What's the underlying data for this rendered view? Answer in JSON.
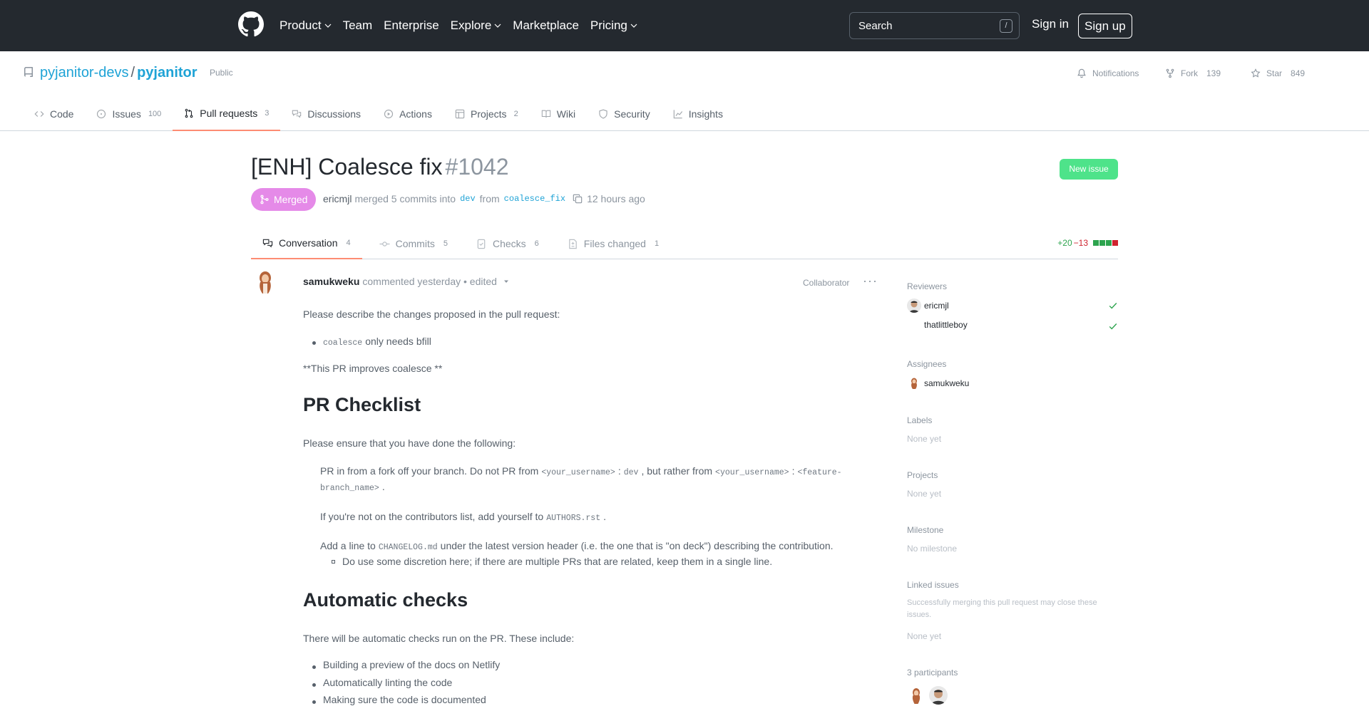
{
  "header": {
    "nav": [
      {
        "label": "Product",
        "dropdown": true
      },
      {
        "label": "Team",
        "dropdown": false
      },
      {
        "label": "Enterprise",
        "dropdown": false
      },
      {
        "label": "Explore",
        "dropdown": true
      },
      {
        "label": "Marketplace",
        "dropdown": false
      },
      {
        "label": "Pricing",
        "dropdown": true
      }
    ],
    "search_placeholder": "Search",
    "search_shortcut": "/",
    "sign_in": "Sign in",
    "sign_up": "Sign up"
  },
  "repo": {
    "owner": "pyjanitor-devs",
    "separator": "/",
    "name": "pyjanitor",
    "visibility": "Public",
    "notifications_label": "Notifications",
    "fork_label": "Fork",
    "fork_count": "139",
    "star_label": "Star",
    "star_count": "849",
    "tabs": [
      {
        "label": "Code",
        "count": ""
      },
      {
        "label": "Issues",
        "count": "100"
      },
      {
        "label": "Pull requests",
        "count": "3"
      },
      {
        "label": "Discussions",
        "count": ""
      },
      {
        "label": "Actions",
        "count": ""
      },
      {
        "label": "Projects",
        "count": "2"
      },
      {
        "label": "Wiki",
        "count": ""
      },
      {
        "label": "Security",
        "count": ""
      },
      {
        "label": "Insights",
        "count": ""
      }
    ]
  },
  "pr": {
    "title": "[ENH] Coalesce fix",
    "number": "#1042",
    "new_issue": "New issue",
    "status": "Merged",
    "author": "ericmjl",
    "meta_merged": "merged 5 commits into",
    "base_branch": "dev",
    "meta_from": "from",
    "head_branch": "coalesce_fix",
    "time_ago": "12 hours ago",
    "tabs": [
      {
        "label": "Conversation",
        "count": "4"
      },
      {
        "label": "Commits",
        "count": "5"
      },
      {
        "label": "Checks",
        "count": "6"
      },
      {
        "label": "Files changed",
        "count": "1"
      }
    ],
    "additions": "+20",
    "deletions": "−13",
    "diff_colors": [
      "#2da44e",
      "#2da44e",
      "#2da44e",
      "#cf222e"
    ]
  },
  "comment": {
    "author": "samukweku",
    "meta": "commented yesterday • edited",
    "role": "Collaborator",
    "more": "···",
    "intro": "Please describe the changes proposed in the pull request:",
    "bullet_code": "coalesce",
    "bullet_text": "only needs bfill",
    "improves": "**This PR improves coalesce **",
    "h_checklist": "PR Checklist",
    "ensure": "Please ensure that you have done the following:",
    "item1_a": "PR in from a fork off your branch. Do not PR from",
    "item1_code1": "<your_username>",
    "item1_b": ":",
    "item1_code2": "dev",
    "item1_c": ", but rather from",
    "item1_code3": "<your_username>",
    "item1_d": ":",
    "item1_code4": "<feature-",
    "item1_code5": "branch_name>",
    "item1_e": ".",
    "item2_a": "If you're not on the contributors list, add yourself to",
    "item2_code": "AUTHORS.rst",
    "item2_b": ".",
    "item3_a": "Add a line to",
    "item3_code": "CHANGELOG.md",
    "item3_b": "under the latest version header (i.e. the one that is \"on deck\") describing the contribution.",
    "item3_sub": "Do use some discretion here; if there are multiple PRs that are related, keep them in a single line.",
    "h_auto": "Automatic checks",
    "auto_intro": "There will be automatic checks run on the PR. These include:",
    "auto_items": [
      "Building a preview of the docs on Netlify",
      "Automatically linting the code",
      "Making sure the code is documented"
    ]
  },
  "sidebar": {
    "reviewers_h": "Reviewers",
    "reviewers": [
      "ericmjl",
      "thatlittleboy"
    ],
    "assignees_h": "Assignees",
    "assignee": "samukweku",
    "labels_h": "Labels",
    "labels_none": "None yet",
    "projects_h": "Projects",
    "projects_none": "None yet",
    "milestone_h": "Milestone",
    "milestone_none": "No milestone",
    "linked_h": "Linked issues",
    "linked_desc_1": "Successfully merging this pull request may close these",
    "linked_desc_2": "issues.",
    "linked_none": "None yet",
    "participants_h": "3 participants"
  }
}
